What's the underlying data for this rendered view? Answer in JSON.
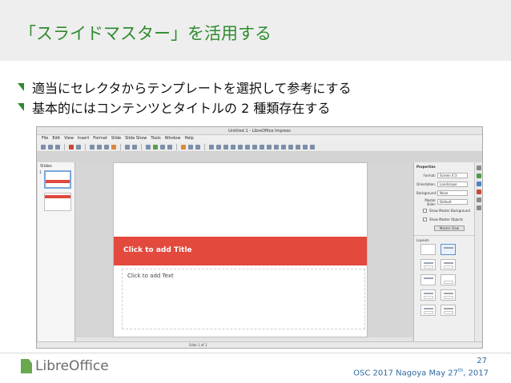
{
  "slide": {
    "title": "「スライドマスター」を活用する",
    "bullets": [
      "適当にセレクタからテンプレートを選択して参考にする",
      "基本的にはコンテンツとタイトルの 2 種類存在する"
    ],
    "page_number": "27",
    "footer_pre": "OSC 2017 Nagoya May 27",
    "footer_sup": "th",
    "footer_post": ", 2017",
    "logo_text": "LibreOffice"
  },
  "app": {
    "window_title": "Untitled 1 - LibreOffice Impress",
    "menu": [
      "File",
      "Edit",
      "View",
      "Insert",
      "Format",
      "Slide",
      "Slide Show",
      "Tools",
      "Window",
      "Help"
    ],
    "slides_pane_title": "Slides",
    "title_placeholder": "Click to add Title",
    "content_placeholder": "Click to add Text",
    "sidebar": {
      "properties_title": "Properties",
      "rows": [
        {
          "label": "Format:",
          "value": "Screen 4:3"
        },
        {
          "label": "Orientation:",
          "value": "Landscape"
        },
        {
          "label": "Background:",
          "value": "None"
        },
        {
          "label": "Master Slide:",
          "value": "Default"
        }
      ],
      "checkboxes": [
        "Show Master Background",
        "Show Master Objects"
      ],
      "master_view_button": "Master View",
      "layouts_title": "Layouts"
    },
    "status": "Slide 1 of 1"
  },
  "colors": {
    "title_green": "#2e8b2e",
    "accent_red": "#e3493d",
    "footer_blue": "#2b6aa0"
  }
}
